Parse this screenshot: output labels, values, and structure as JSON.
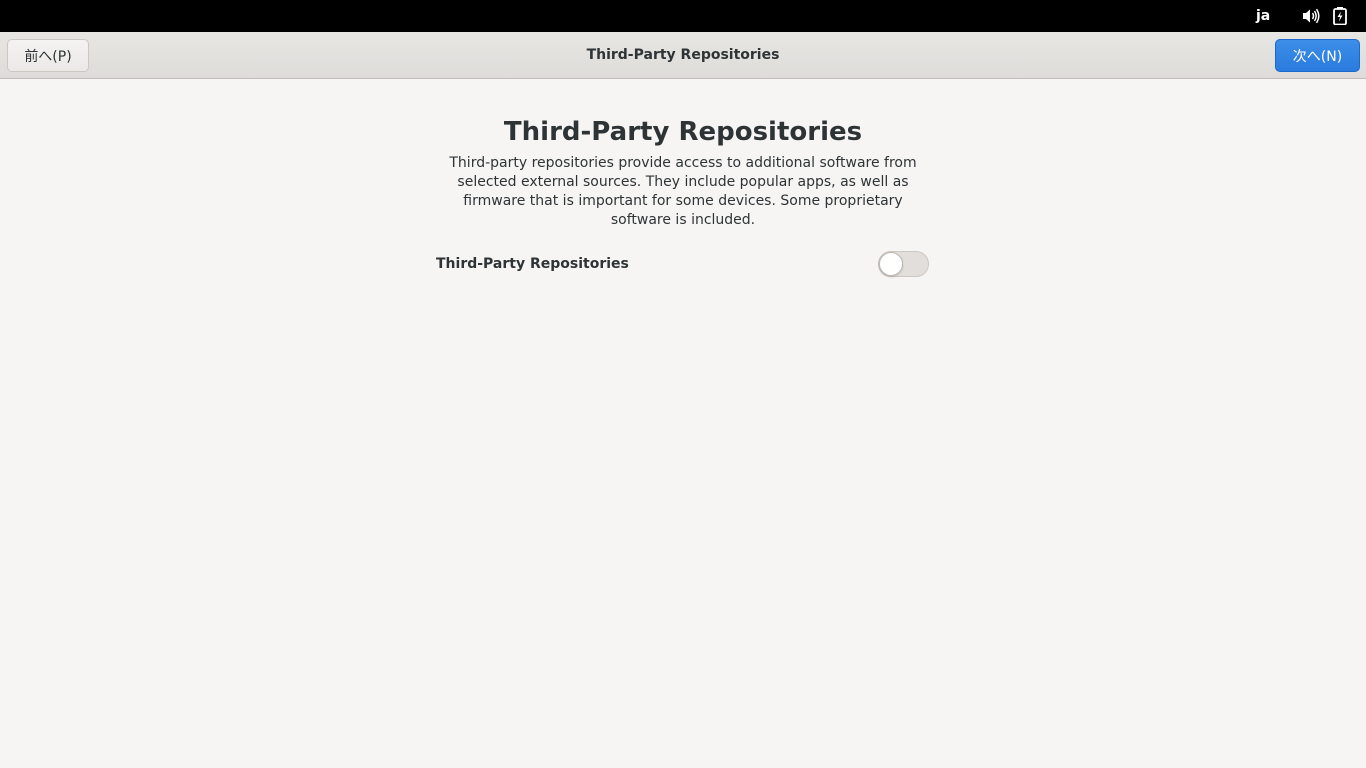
{
  "topbar": {
    "language": "ja",
    "volume_icon": "speaker-icon",
    "battery_icon": "battery-charging-icon"
  },
  "header": {
    "prev_label": "前へ(P)",
    "next_label": "次へ(N)",
    "title": "Third-Party Repositories"
  },
  "main": {
    "title": "Third-Party Repositories",
    "description": "Third-party repositories provide access to additional software from selected external sources. They include popular apps, as well as firmware that is important for some devices. Some proprietary software is included.",
    "toggle_label": "Third-Party Repositories",
    "toggle_state": "off"
  },
  "colors": {
    "accent": "#3584e4",
    "background": "#f6f5f4",
    "topbar": "#000000"
  }
}
